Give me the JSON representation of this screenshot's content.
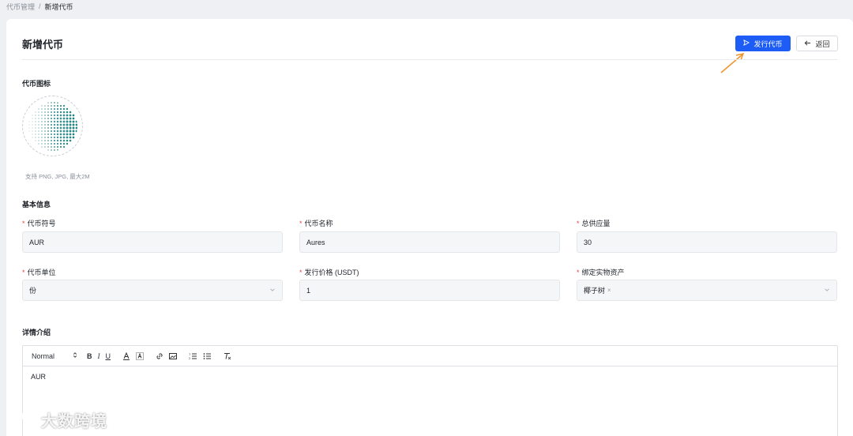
{
  "breadcrumb": {
    "parent": "代币管理",
    "separator": "/",
    "current": "新增代币"
  },
  "header": {
    "title": "新增代币",
    "issue_button": "发行代币",
    "back_button": "返回"
  },
  "icon_section": {
    "label": "代币图标",
    "hint": "支持 PNG, JPG, 最大2M"
  },
  "basic_info": {
    "label": "基本信息",
    "fields": {
      "symbol": {
        "label": "代币符号",
        "value": "AUR"
      },
      "name": {
        "label": "代币名称",
        "value": "Aures"
      },
      "supply": {
        "label": "总供应量",
        "value": "30"
      },
      "unit": {
        "label": "代币单位",
        "value": "份"
      },
      "price": {
        "label": "发行价格 (USDT)",
        "value": "1"
      },
      "asset": {
        "label": "绑定实物资产",
        "tag": "椰子树"
      }
    }
  },
  "detail": {
    "label": "详情介绍",
    "toolbar": {
      "format": "Normal"
    },
    "content": "AUR"
  },
  "watermark": {
    "text": "大数跨境"
  },
  "colors": {
    "primary": "#1d5cf5",
    "required": "#e0483d",
    "logo": "#1a7f7a"
  }
}
